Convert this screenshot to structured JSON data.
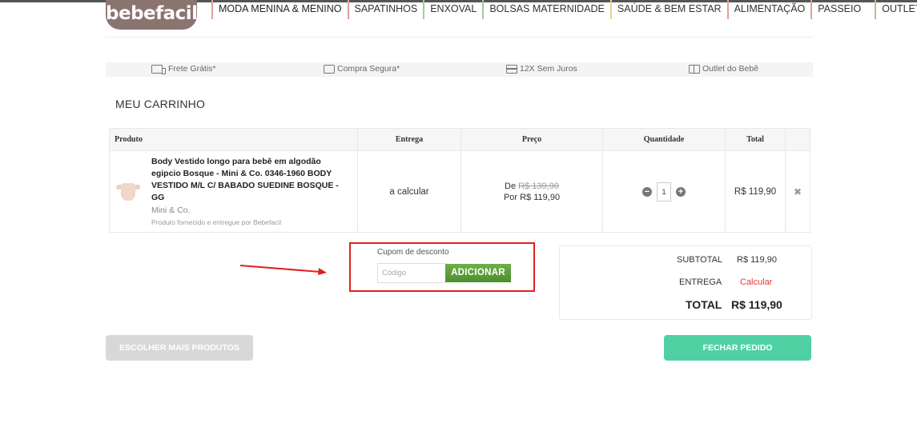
{
  "brand": {
    "logo_text": "bebefacil"
  },
  "nav": {
    "items": [
      {
        "label": "MODA MENINA & MENINO"
      },
      {
        "label": "SAPATINHOS"
      },
      {
        "label": "ENXOVAL"
      },
      {
        "label": "BOLSAS MATERNIDADE"
      },
      {
        "label": "SAÚDE & BEM ESTAR"
      },
      {
        "label": "ALIMENTAÇÃO"
      },
      {
        "label": "PASSEIO"
      },
      {
        "label": "OUTLET"
      }
    ]
  },
  "benefits": [
    {
      "label": "Frete Grátis*",
      "icon": "truck-icon"
    },
    {
      "label": "Compra Segura*",
      "icon": "shield-icon"
    },
    {
      "label": "12X Sem Juros",
      "icon": "card-icon"
    },
    {
      "label": "Outlet do Bebê",
      "icon": "gift-icon"
    }
  ],
  "page_title": "MEU CARRINHO",
  "table": {
    "headers": {
      "produto": "Produto",
      "entrega": "Entrega",
      "preco": "Preço",
      "quantidade": "Quantidade",
      "total": "Total"
    },
    "item": {
      "name": "Body Vestido longo para bebê em algodão egipcio Bosque - Mini & Co. 0346-1960 BODY VESTIDO M/L C/ BABADO SUEDINE BOSQUE - GG",
      "brand": "Mini & Co.",
      "supplier": "Produto fornecido e entregue por Bebefacil",
      "delivery": "a calcular",
      "price_old_prefix": "De",
      "price_old": "R$ 139,90",
      "price_new": "Por R$ 119,90",
      "quantity": "1",
      "total": "R$ 119,90",
      "remove": "✖"
    }
  },
  "coupon": {
    "label": "Cupom de desconto",
    "placeholder": "Código",
    "button": "ADICIONAR"
  },
  "summary": {
    "subtotal_label": "SUBTOTAL",
    "subtotal_value": "R$ 119,90",
    "delivery_label": "ENTREGA",
    "delivery_value": "Calcular",
    "total_label": "TOTAL",
    "total_value": "R$ 119,90"
  },
  "actions": {
    "more_products": "ESCOLHER MAIS PRODUTOS",
    "checkout": "FECHAR PEDIDO"
  },
  "colors": {
    "annotation_red": "#e02020",
    "checkout_green": "#4fd1a4",
    "coupon_green": "#5a9e38"
  }
}
